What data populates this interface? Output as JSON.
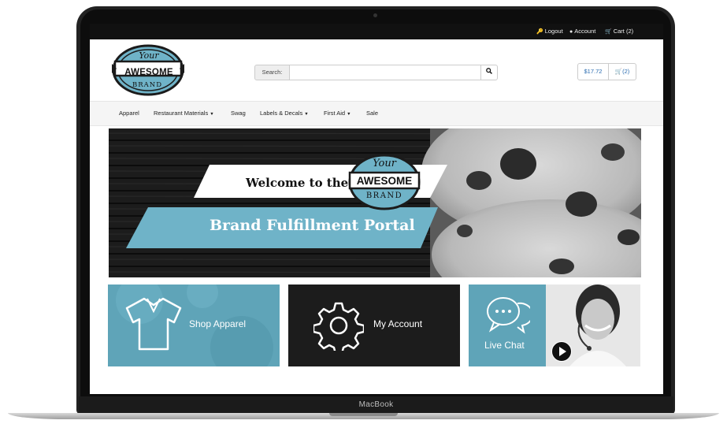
{
  "device": {
    "label": "MacBook"
  },
  "topbar": {
    "logout": "Logout",
    "account": "Account",
    "cart": "Cart (2)"
  },
  "logo": {
    "line1": "Your",
    "line2": "AWESOME",
    "line3": "BRAND"
  },
  "search": {
    "label": "Search:",
    "value": "",
    "placeholder": ""
  },
  "cart_summary": {
    "total": "$17.72",
    "count": "(2)"
  },
  "nav": {
    "items": [
      {
        "label": "Apparel",
        "has_dropdown": false
      },
      {
        "label": "Restaurant Materials",
        "has_dropdown": true
      },
      {
        "label": "Swag",
        "has_dropdown": false
      },
      {
        "label": "Labels & Decals",
        "has_dropdown": true
      },
      {
        "label": "First Aid",
        "has_dropdown": true
      },
      {
        "label": "Sale",
        "has_dropdown": false
      }
    ]
  },
  "hero": {
    "welcome": "Welcome to the",
    "title": "Brand Fulfillment Portal"
  },
  "tiles": [
    {
      "label": "Shop Apparel",
      "icon": "shirt-icon"
    },
    {
      "label": "My Account",
      "icon": "gear-icon"
    },
    {
      "label": "Live Chat",
      "icon": "chat-bubbles-icon"
    }
  ],
  "colors": {
    "accent": "#6fb3c8",
    "dark": "#1a1a1a",
    "link": "#2b6cb0"
  }
}
